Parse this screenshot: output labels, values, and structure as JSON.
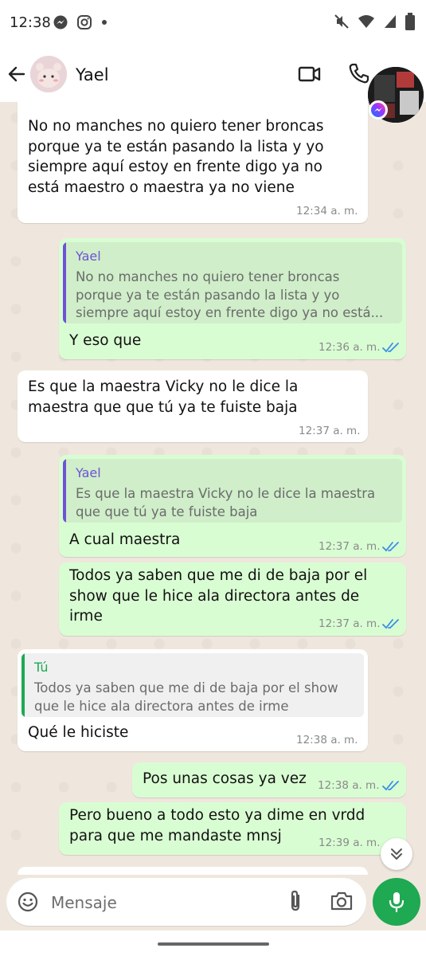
{
  "status_bar": {
    "time": "12:38",
    "left_icons": [
      "messenger-icon",
      "instagram-icon",
      "dot-icon"
    ],
    "right_icons": [
      "mute-icon",
      "wifi-icon",
      "signal-icon",
      "battery-icon"
    ]
  },
  "header": {
    "contact_name": "Yael",
    "icons": [
      "back-arrow-icon",
      "video-call-icon",
      "phone-icon"
    ]
  },
  "chat_bubble_overlay": {
    "badge_icon": "messenger-icon"
  },
  "messages": [
    {
      "direction": "in",
      "text": [
        "No no manches no quiero tener broncas",
        "porque ya te están pasando la lista y yo",
        "siempre aquí estoy en frente digo ya no",
        "está maestro o maestra ya no viene"
      ],
      "time": "12:34 a. m."
    },
    {
      "direction": "out",
      "quote_author": "Yael",
      "quote_text": [
        "No no manches no quiero tener broncas",
        "porque ya te están pasando la lista y yo",
        "siempre aquí estoy en frente digo ya no está..."
      ],
      "text": [
        "Y eso que"
      ],
      "time": "12:36 a. m.",
      "status": "read"
    },
    {
      "direction": "in",
      "text": [
        "Es que la maestra Vicky no le dice la",
        "maestra que que tú ya te fuiste baja"
      ],
      "time": "12:37 a. m."
    },
    {
      "direction": "out",
      "quote_author": "Yael",
      "quote_text": [
        "Es que la maestra Vicky no le dice la maestra",
        "que que tú ya te fuiste baja"
      ],
      "text": [
        "A cual maestra"
      ],
      "time": "12:37 a. m.",
      "status": "read"
    },
    {
      "direction": "out",
      "text": [
        "Todos ya saben que me di de baja por el",
        "show que le hice ala directora antes de",
        "irme"
      ],
      "time": "12:37 a. m.",
      "status": "read"
    },
    {
      "direction": "in",
      "quote_author": "Tú",
      "quote_text": [
        "Todos ya saben que me di de baja por el show",
        "que le hice ala directora antes de irme"
      ],
      "text": [
        "Qué le hiciste"
      ],
      "time": "12:38 a. m."
    },
    {
      "direction": "out",
      "text": [
        "Pos unas cosas ya vez"
      ],
      "time": "12:38 a. m.",
      "status": "read"
    },
    {
      "direction": "out",
      "text": [
        "Pero bueno a todo esto ya dime en vrdd",
        "para que me mandaste mnsj"
      ],
      "time": "12:39 a. m.",
      "status": "read"
    }
  ],
  "input": {
    "placeholder": "Mensaje",
    "value": "",
    "icons": [
      "emoji-icon",
      "paperclip-icon",
      "camera-icon",
      "microphone-icon"
    ]
  },
  "colors": {
    "incoming_bubble": "#ffffff",
    "outgoing_bubble": "#d9fdd3",
    "quote_bar_contact": "#6f52d6",
    "quote_bar_self": "#1fa855",
    "read_ticks": "#3a8fe6",
    "mic_button": "#1ea952",
    "wallpaper": "#efe7dd"
  }
}
